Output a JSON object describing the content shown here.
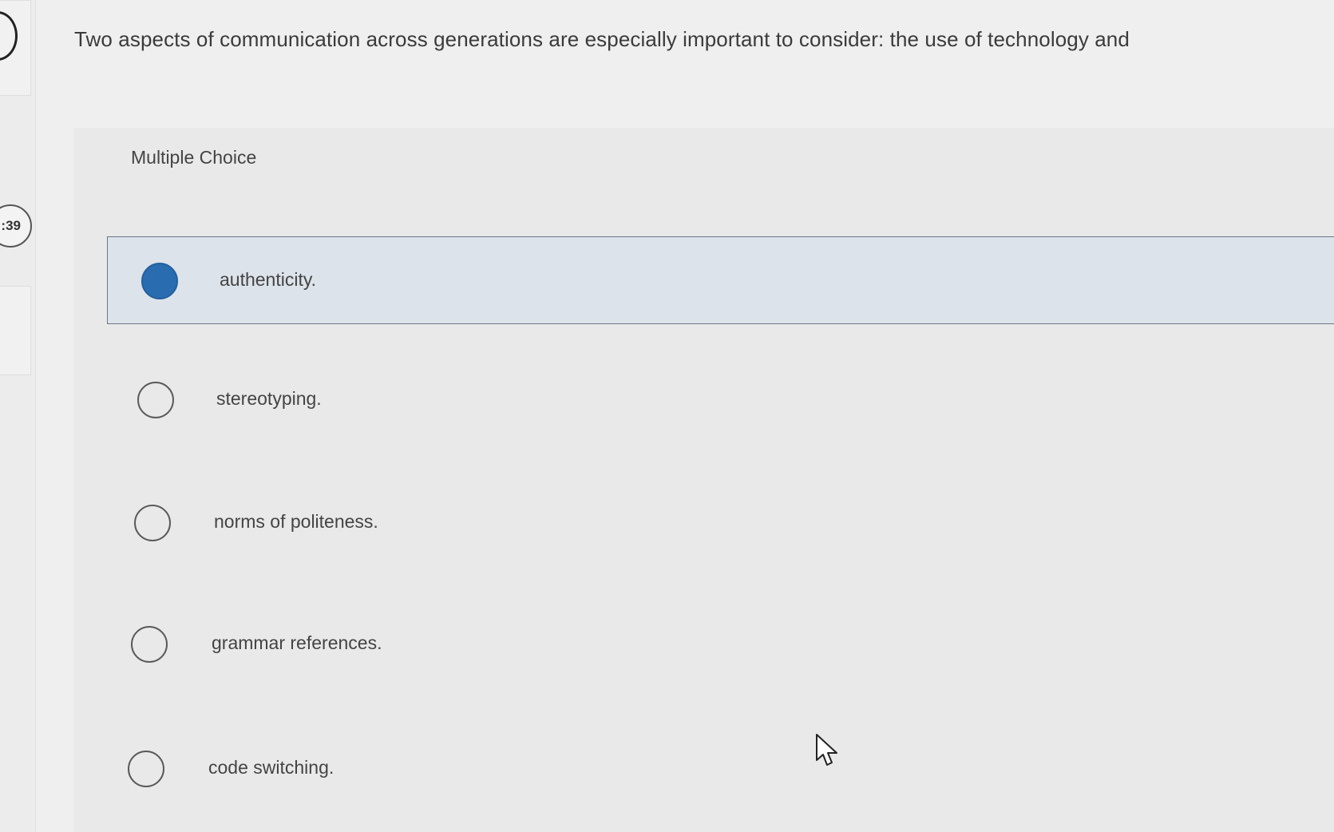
{
  "question": {
    "text": "Two aspects of communication across generations are especially important to consider: the use of technology and"
  },
  "timer": {
    "text": ":39"
  },
  "section_label": "Multiple Choice",
  "options": [
    {
      "label": "authenticity.",
      "selected": true
    },
    {
      "label": "stereotyping.",
      "selected": false
    },
    {
      "label": "norms of politeness.",
      "selected": false
    },
    {
      "label": "grammar references.",
      "selected": false
    },
    {
      "label": "code switching.",
      "selected": false
    }
  ],
  "colors": {
    "selected_radio": "#2a6cb0",
    "selected_row_bg": "#dde3ea"
  },
  "icons": {
    "cursor": "mouse-pointer-icon"
  }
}
